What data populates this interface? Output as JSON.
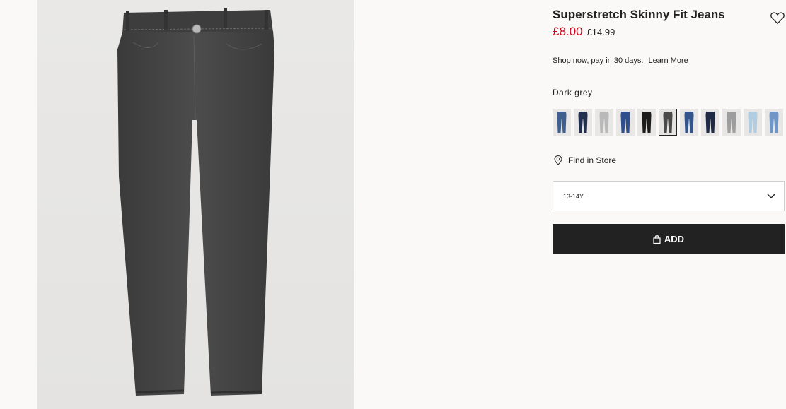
{
  "product": {
    "title": "Superstretch Skinny Fit Jeans",
    "price": "£8.00",
    "old_price": "£14.99",
    "image_icon": "jeans-product-photo"
  },
  "payment": {
    "text": "Shop now, pay in 30 days.",
    "link": "Learn More"
  },
  "colors": {
    "selected_label": "Dark grey",
    "swatches": [
      {
        "color": "#3f5f8f",
        "selected": false
      },
      {
        "color": "#22304f",
        "selected": false
      },
      {
        "color": "#b9b9b9",
        "selected": false
      },
      {
        "color": "#2f4f8d",
        "selected": false
      },
      {
        "color": "#1c1c1c",
        "selected": false
      },
      {
        "color": "#4a4a4a",
        "selected": true
      },
      {
        "color": "#33558c",
        "selected": false
      },
      {
        "color": "#1f2a45",
        "selected": false
      },
      {
        "color": "#9d9d9d",
        "selected": false
      },
      {
        "color": "#b3cde0",
        "selected": false
      },
      {
        "color": "#6f96c4",
        "selected": false
      }
    ]
  },
  "store": {
    "label": "Find in Store",
    "icon": "location-pin-icon"
  },
  "size": {
    "selected": "13-14Y",
    "icon": "chevron-down-icon"
  },
  "cart": {
    "label": "ADD",
    "icon": "shopping-bag-icon"
  },
  "favorite": {
    "icon": "heart-icon"
  },
  "theme": {
    "sale_price_color": "#d0021b",
    "button_color": "#222222"
  }
}
